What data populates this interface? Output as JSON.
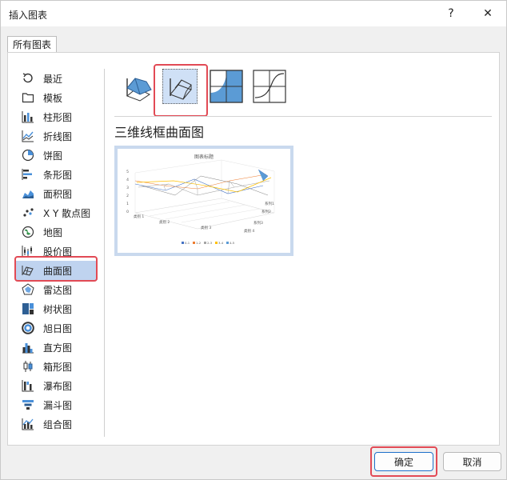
{
  "window": {
    "title": "插入图表",
    "help_label": "?",
    "close_label": "✕"
  },
  "tabs": [
    {
      "label": "所有图表"
    }
  ],
  "nav": {
    "items": [
      {
        "label": "最近",
        "icon": "recent-icon"
      },
      {
        "label": "模板",
        "icon": "folder-icon"
      },
      {
        "label": "柱形图",
        "icon": "column-chart-icon"
      },
      {
        "label": "折线图",
        "icon": "line-chart-icon"
      },
      {
        "label": "饼图",
        "icon": "pie-chart-icon"
      },
      {
        "label": "条形图",
        "icon": "bar-chart-icon"
      },
      {
        "label": "面积图",
        "icon": "area-chart-icon"
      },
      {
        "label": "X Y 散点图",
        "icon": "scatter-chart-icon"
      },
      {
        "label": "地图",
        "icon": "map-chart-icon"
      },
      {
        "label": "股价图",
        "icon": "stock-chart-icon"
      },
      {
        "label": "曲面图",
        "icon": "surface-chart-icon"
      },
      {
        "label": "雷达图",
        "icon": "radar-chart-icon"
      },
      {
        "label": "树状图",
        "icon": "treemap-chart-icon"
      },
      {
        "label": "旭日图",
        "icon": "sunburst-chart-icon"
      },
      {
        "label": "直方图",
        "icon": "histogram-chart-icon"
      },
      {
        "label": "箱形图",
        "icon": "box-whisker-chart-icon"
      },
      {
        "label": "瀑布图",
        "icon": "waterfall-chart-icon"
      },
      {
        "label": "漏斗图",
        "icon": "funnel-chart-icon"
      },
      {
        "label": "组合图",
        "icon": "combo-chart-icon"
      }
    ],
    "selected_index": 10
  },
  "chart_types": [
    {
      "icon": "3d-surface-icon"
    },
    {
      "icon": "wireframe-3d-surface-icon",
      "selected": true
    },
    {
      "icon": "contour-icon"
    },
    {
      "icon": "wireframe-contour-icon"
    }
  ],
  "selected_type_label": "三维线框曲面图",
  "preview": {
    "title": "图表标题",
    "y_ticks": [
      "5",
      "4",
      "3",
      "2",
      "1",
      "0"
    ],
    "categories": [
      "类别 1",
      "类别 2",
      "类别 3",
      "类别 4"
    ],
    "series_axis": [
      "系列1",
      "系列2",
      "系列3"
    ],
    "legend": [
      "0-1",
      "1-2",
      "2-3",
      "3-4",
      "4-5"
    ],
    "legend_colors": [
      "#4472c4",
      "#ed7d31",
      "#a5a5a5",
      "#ffc000",
      "#5b9bd5"
    ]
  },
  "buttons": {
    "ok_label": "确定",
    "cancel_label": "取消"
  },
  "colors": {
    "accent": "#1c6fc9",
    "selection": "#bfd3ef",
    "highlight_box": "#e24a55",
    "surface_blue": "#5b9bd5"
  }
}
